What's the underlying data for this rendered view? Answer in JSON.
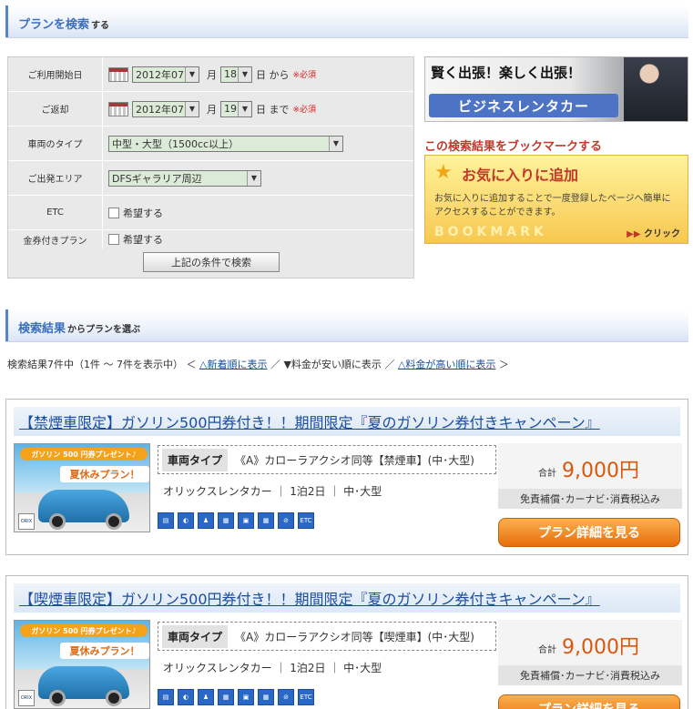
{
  "search_section": {
    "title": "プランを検索",
    "title_suffix": "する"
  },
  "form": {
    "rows": [
      {
        "label": "ご利用開始日",
        "year_month": "2012年07",
        "month_unit": "月",
        "day": "18",
        "after": "日 から",
        "required": "※必須"
      },
      {
        "label": "ご返却",
        "year_month": "2012年07",
        "month_unit": "月",
        "day": "19",
        "after": "日 まで",
        "required": "※必須"
      },
      {
        "label": "車両のタイプ",
        "value": "中型・大型（1500cc以上）"
      },
      {
        "label": "ご出発エリア",
        "value": "DFSギャラリア周辺"
      },
      {
        "label": "ETC",
        "checkbox_label": "希望する"
      },
      {
        "label": "金券付きプラン",
        "checkbox_label": "希望する"
      }
    ],
    "search_button": "上記の条件で検索"
  },
  "banner_biz": {
    "line1": "賢く出張！楽しく出張！",
    "line2": "ビジネスレンタカー"
  },
  "bookmark": {
    "title": "この検索結果をブックマークする",
    "heading": "お気に入りに追加",
    "desc": "お気に入りに追加することで一度登録したページへ簡単にアクセスすることができます。",
    "watermark": "BOOKMARK",
    "click_arrows": "▶▶",
    "click": "クリック"
  },
  "results_section": {
    "title": "検索結果",
    "title_suffix": "からプランを選ぶ"
  },
  "results_meta": {
    "summary": "検索結果7件中（1件 〜 7件を表示中）",
    "open": "＜",
    "sort_new": "△新着順に表示",
    "sep1": "／",
    "sort_cheap": "▼料金が安い順に表示",
    "sep2": "／",
    "sort_expensive": "△料金が高い順に表示",
    "close": "＞"
  },
  "results": [
    {
      "title": "【禁煙車限定】ガソリン500円券付き！！期間限定『夏のガソリン券付きキャンペーン』",
      "img_badge": "ガソリン 500 円券プレゼント♪",
      "img_text": "夏休みプラン！",
      "img_logo": "ORIX",
      "type_label": "車両タイプ",
      "type_value": "《A》カローラアクシオ同等【禁煙車】(中･大型)",
      "sub": "オリックスレンタカー ｜ 1泊2日 ｜ 中･大型",
      "price_label": "合計",
      "price": "9,000円",
      "price_note": "免責補償･カーナビ･消費税込み",
      "button": "プラン詳細を見る",
      "icons": [
        "ETC"
      ]
    },
    {
      "title": "【喫煙車限定】ガソリン500円券付き！！期間限定『夏のガソリン券付きキャンペーン』",
      "img_badge": "ガソリン 500 円券プレゼント♪",
      "img_text": "夏休みプラン！",
      "img_logo": "ORIX",
      "type_label": "車両タイプ",
      "type_value": "《A》カローラアクシオ同等【喫煙車】(中･大型)",
      "sub": "オリックスレンタカー ｜ 1泊2日 ｜ 中･大型",
      "price_label": "合計",
      "price": "9,000円",
      "price_note": "免責補償･カーナビ･消費税込み",
      "button": "プラン詳細を見る",
      "icons": [
        "ETC"
      ]
    }
  ]
}
